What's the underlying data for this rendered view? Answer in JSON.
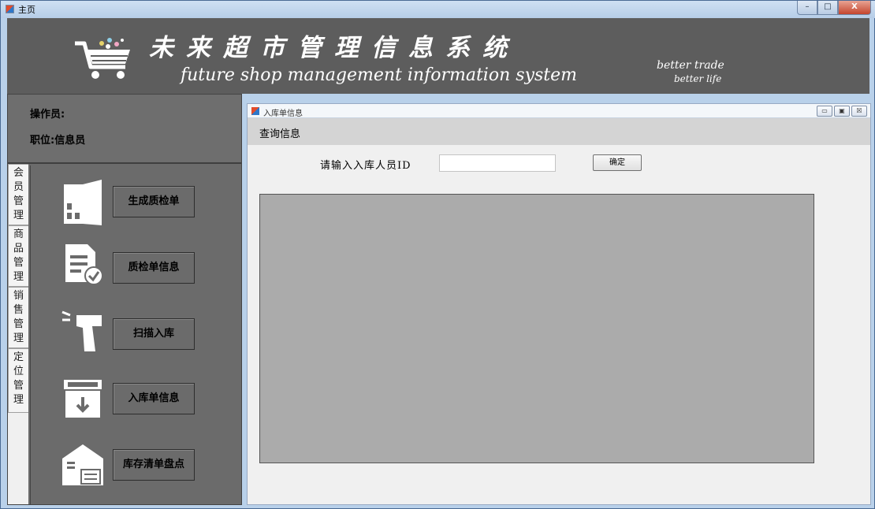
{
  "window": {
    "title": "主页",
    "controls": {
      "minimize": "–",
      "maximize": "□",
      "close": "X"
    }
  },
  "banner": {
    "title_cn": "未来超市管理信息系统",
    "title_en": "future shop management information system",
    "slogan_line1": "better trade",
    "slogan_line2": "better life"
  },
  "operator": {
    "operator_label": "操作员:",
    "position_label": "职位:信息员"
  },
  "vertical_tabs": [
    {
      "label": "会员管理"
    },
    {
      "label": "商品管理"
    },
    {
      "label": "销售管理"
    },
    {
      "label": "定位管理"
    }
  ],
  "nav": [
    {
      "label": "生成质检单",
      "icon": "building-icon"
    },
    {
      "label": "质检单信息",
      "icon": "document-check-icon"
    },
    {
      "label": "扫描入库",
      "icon": "barcode-scanner-icon"
    },
    {
      "label": "入库单信息",
      "icon": "archive-box-icon"
    },
    {
      "label": "库存清单盘点",
      "icon": "warehouse-icon"
    }
  ],
  "child_window": {
    "title": "入库单信息",
    "controls": {
      "minimize": "▭",
      "maximize": "▣",
      "close": "☒"
    },
    "menu": "查询信息",
    "query_label": "请输入入库人员ID",
    "query_value": "",
    "confirm_button": "确定"
  },
  "colors": {
    "banner_bg": "#5d5d5d",
    "sidebar_bg": "#6b6b6b",
    "grid_bg": "#ababab",
    "menubar_bg": "#d4d4d4"
  }
}
